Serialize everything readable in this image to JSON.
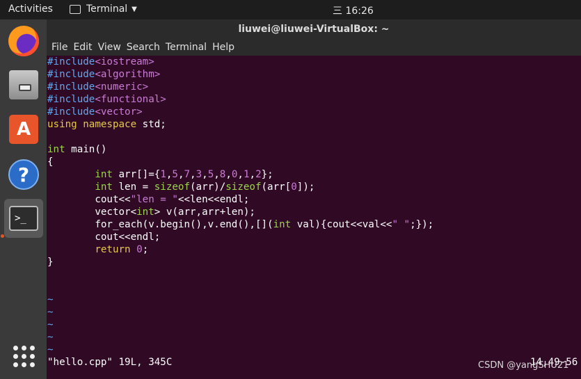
{
  "topbar": {
    "activities": "Activities",
    "app_name": "Terminal",
    "clock_icon": "三",
    "clock": "16:26"
  },
  "dock": {
    "items": [
      "firefox-icon",
      "files-icon",
      "software-icon",
      "help-icon",
      "terminal-icon",
      "show-apps-icon"
    ],
    "software_glyph": "A",
    "help_glyph": "?",
    "terminal_glyph": ">_"
  },
  "window": {
    "title": "liuwei@liuwei-VirtualBox: ~",
    "menu": [
      "File",
      "Edit",
      "View",
      "Search",
      "Terminal",
      "Help"
    ]
  },
  "editor": {
    "lines": [
      "#include<iostream>",
      "#include<algorithm>",
      "#include<numeric>",
      "#include<functional>",
      "#include<vector>",
      "using namespace std;",
      "",
      "int main()",
      "{",
      "        int arr[]={1,5,7,3,5,8,0,1,2};",
      "        int len = sizeof(arr)/sizeof(arr[0]);",
      "        cout<<\"len = \"<<len<<endl;",
      "        vector<int> v(arr,arr+len);",
      "        for_each(v.begin(),v.end(),[](int val){cout<<val<<\" \";});",
      "        cout<<endl;",
      "        return 0;",
      "}",
      "",
      "",
      "~",
      "~",
      "~",
      "~",
      "~"
    ],
    "status": "\"hello.cpp\" 19L, 345C",
    "position": "14,49-56"
  },
  "watermark": "CSDN @yangSHU21",
  "colors": {
    "background": "#300a24",
    "preprocessor": "#5fa8f0",
    "string": "#c97bd6",
    "type": "#9ad54b",
    "keyword": "#e6c84a",
    "accent": "#e95420"
  }
}
